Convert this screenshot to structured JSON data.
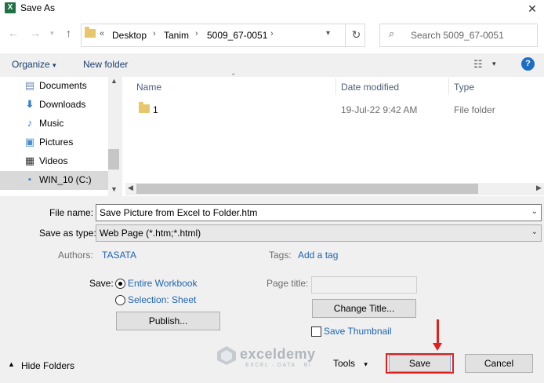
{
  "window": {
    "title": "Save As",
    "app_icon": "X",
    "close_glyph": "✕"
  },
  "nav": {
    "back_icon": "back-arrow-icon",
    "breadcrumb": [
      "Desktop",
      "Tanim",
      "5009_67-0051"
    ],
    "breadcrumb_prefix": "«",
    "search_placeholder": "Search 5009_67-0051"
  },
  "toolbar": {
    "organize_label": "Organize",
    "new_folder_label": "New folder",
    "help_label": "?"
  },
  "sidebar": {
    "items": [
      {
        "label": "Documents",
        "icon": "documents-icon"
      },
      {
        "label": "Downloads",
        "icon": "downloads-icon"
      },
      {
        "label": "Music",
        "icon": "music-icon"
      },
      {
        "label": "Pictures",
        "icon": "pictures-icon"
      },
      {
        "label": "Videos",
        "icon": "videos-icon"
      },
      {
        "label": "WIN_10 (C:)",
        "icon": "drive-icon"
      }
    ]
  },
  "filelist": {
    "columns": [
      "Name",
      "Date modified",
      "Type"
    ],
    "rows": [
      {
        "name": "1",
        "date": "19-Jul-22 9:42 AM",
        "type": "File folder"
      }
    ]
  },
  "form": {
    "file_name_label": "File name:",
    "file_name_value": "Save Picture from Excel to Folder.htm",
    "save_type_label": "Save as type:",
    "save_type_value": "Web Page (*.htm;*.html)",
    "authors_label": "Authors:",
    "authors_value": "TASATA",
    "tags_label": "Tags:",
    "tags_value": "Add a tag",
    "save_label": "Save:",
    "option_entire": "Entire Workbook",
    "option_selection": "Selection: Sheet",
    "publish_label": "Publish...",
    "page_title_label": "Page title:",
    "change_title_label": "Change Title...",
    "save_thumbnail_label": "Save Thumbnail"
  },
  "footer": {
    "hide_folders_label": "Hide Folders",
    "tools_label": "Tools",
    "save_button": "Save",
    "cancel_button": "Cancel"
  },
  "watermark": {
    "name": "exceldemy",
    "tagline": "EXCEL · DATA · BI"
  },
  "colors": {
    "accent_link": "#1e64b4",
    "annotation_red": "#e3211c",
    "excel_green": "#1f7244"
  }
}
